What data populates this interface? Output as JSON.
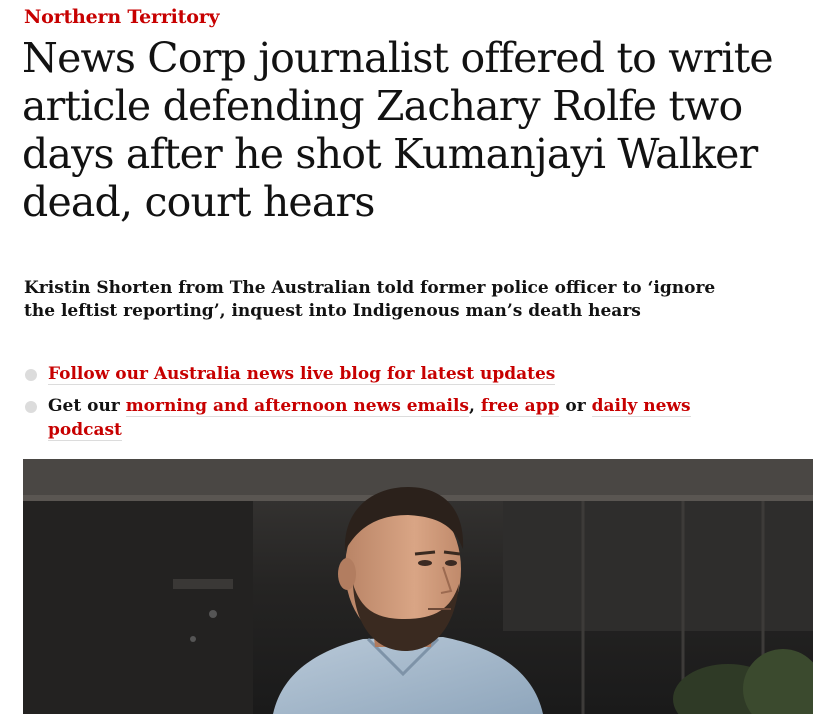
{
  "article": {
    "section": "Northern Territory",
    "headline": "News Corp journalist offered to write article defending Zachary Rolfe two days after he shot Kumanjayi Walker dead, court hears",
    "standfirst": "Kristin Shorten from The Australian told former police officer to ‘ignore the leftist reporting’, inquest into Indigenous man’s death hears",
    "bullets": {
      "first": {
        "link": "Follow our Australia news live blog for latest updates"
      },
      "second": {
        "prefix": "Get our ",
        "link1": "morning and afternoon news emails",
        "sep1": ", ",
        "link2": "free app",
        "sep2": " or ",
        "link3": "daily news podcast"
      }
    }
  },
  "colors": {
    "accent": "#c70000",
    "text": "#121212",
    "bullet": "#dcdcdc"
  }
}
